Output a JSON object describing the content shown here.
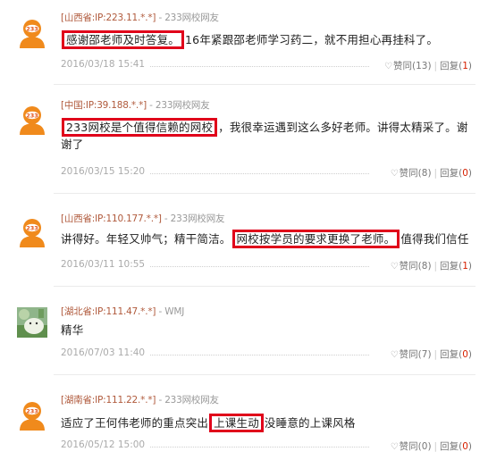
{
  "comments": [
    {
      "location": "[山西省:IP:223.11.*.*]",
      "sep": " - ",
      "user": "233网校网友",
      "text_pre": "",
      "highlight": "感谢邵老师及时答复。",
      "text_post": "16年紧跟邵老师学习药二，就不用担心再挂科了。",
      "date": "2016/03/18 15:41",
      "like_label": "赞同(13)",
      "reply_label": "回复(",
      "reply_count": "1",
      "reply_close": ")"
    },
    {
      "location": "[中国:IP:39.188.*.*]",
      "sep": " - ",
      "user": "233网校网友",
      "text_pre": "",
      "highlight": "233网校是个值得信赖的网校",
      "text_post": "，我很幸运遇到这么多好老师。讲得太精采了。谢谢了",
      "date": "2016/03/15 15:20",
      "like_label": "赞同(8)",
      "reply_label": "回复(",
      "reply_count": "0",
      "reply_close": ")"
    },
    {
      "location": "[山西省:IP:110.177.*.*]",
      "sep": " - ",
      "user": "233网校网友",
      "text_pre": "讲得好。年轻又帅气；精干简洁。",
      "highlight": "网校按学员的要求更换了老师。",
      "text_post": "值得我们信任",
      "date": "2016/03/11 10:55",
      "like_label": "赞同(8)",
      "reply_label": "回复(",
      "reply_count": "1",
      "reply_close": ")"
    },
    {
      "location": "[湖北省:IP:111.47.*.*]",
      "sep": " - ",
      "user": "WMJ",
      "text_pre": "精华",
      "highlight": "",
      "text_post": "",
      "date": "2016/07/03 11:40",
      "like_label": "赞同(7)",
      "reply_label": "回复(",
      "reply_count": "0",
      "reply_close": ")"
    },
    {
      "location": "[湖南省:IP:111.22.*.*]",
      "sep": " - ",
      "user": "233网校网友",
      "text_pre": "适应了王何伟老师的重点突出",
      "highlight": "上课生动",
      "text_post": "没睡意的上课风格",
      "date": "2016/05/12 15:00",
      "like_label": "赞同(0)",
      "reply_label": "回复(",
      "reply_count": "0",
      "reply_close": ")"
    }
  ],
  "avatar_badge": "233",
  "colors": {
    "highlight_border": "#e0001a",
    "location_text": "#b05a3c",
    "reply_count": "#d62000",
    "avatar_orange": "#f08a1c"
  },
  "icons": {
    "like": "heart-outline-icon"
  }
}
